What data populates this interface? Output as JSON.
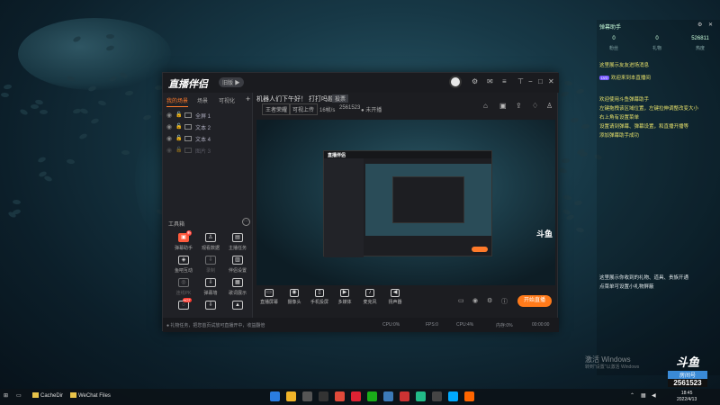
{
  "app": {
    "logo": "直播伴侣",
    "version": "旧版 ▶",
    "scene_tabs": [
      "我的场景",
      "场景",
      "可视化"
    ],
    "sources": [
      {
        "name": "全屏 1",
        "dim": false
      },
      {
        "name": "文本 2",
        "dim": false
      },
      {
        "name": "文本 4",
        "dim": false
      },
      {
        "name": "图片 3",
        "dim": true
      }
    ],
    "tools_heading": "工具箱",
    "tools": [
      {
        "label": "弹幕助手",
        "icon": "▣",
        "badge": "新",
        "highlight": true,
        "dim": false
      },
      {
        "label": "观看数据",
        "icon": "♙",
        "badge": "",
        "highlight": false,
        "dim": false
      },
      {
        "label": "主播任务",
        "icon": "▤",
        "badge": "",
        "highlight": false,
        "dim": false
      },
      {
        "label": "鱼吧互动",
        "icon": "◈",
        "badge": "",
        "highlight": false,
        "dim": false
      },
      {
        "label": "录制",
        "icon": "⇩",
        "badge": "",
        "highlight": false,
        "dim": true
      },
      {
        "label": "伴侣设置",
        "icon": "▥",
        "badge": "",
        "highlight": false,
        "dim": false
      },
      {
        "label": "连线PK",
        "icon": "◎",
        "badge": "",
        "highlight": false,
        "dim": true
      },
      {
        "label": "弹幕墙",
        "icon": "⇩",
        "badge": "",
        "highlight": false,
        "dim": false
      },
      {
        "label": "歌词展示",
        "icon": "▦",
        "badge": "",
        "highlight": false,
        "dim": false
      },
      {
        "label": "",
        "icon": "◌",
        "badge": "HOT",
        "highlight": false,
        "dim": false
      },
      {
        "label": "",
        "icon": "⇩",
        "badge": "",
        "highlight": false,
        "dim": false
      },
      {
        "label": "",
        "icon": "▲",
        "badge": "",
        "highlight": false,
        "dim": false
      }
    ],
    "room_title": "机器人们下午好！ 打打吗题！",
    "vote_label": "投票",
    "row2": {
      "category": "王者荣耀",
      "tag": "可视上传",
      "fps": "16帧/s",
      "room_id": "2561523",
      "status": "● 未开播"
    },
    "bottom_buttons": [
      {
        "label": "直播屏幕",
        "icon": "▭"
      },
      {
        "label": "摄像头",
        "icon": "◉"
      },
      {
        "label": "手机投屏",
        "icon": "▯"
      },
      {
        "label": "多媒体",
        "icon": "▶"
      },
      {
        "label": "麦克风",
        "icon": "♪"
      },
      {
        "label": "扬声器",
        "icon": "◀"
      }
    ],
    "go_live": "开始直播",
    "status_left": "● 礼物任务，把您首页试放可直播开中，收益翻倍",
    "status_items": [
      "CPU:0%",
      "FPS:0",
      "CPU:4%",
      "内存:0%"
    ],
    "status_time": "00:00:00"
  },
  "right_panel": {
    "title": "弹幕助手",
    "stats": [
      {
        "value": "0",
        "key": "粉丝"
      },
      {
        "value": "0",
        "key": "礼物"
      },
      {
        "value": "526811",
        "key": "热度"
      }
    ],
    "lines": [
      {
        "text": "这里展示友友进场消息",
        "white": false
      },
      {
        "text": "欢迎来到本直播间",
        "white": false,
        "level": "LV0"
      },
      {
        "text": "欢迎使用斗鱼弹幕助手",
        "white": false
      },
      {
        "text": "左键拖拽该区域位置，左键拉伸调整改变大小",
        "white": false
      },
      {
        "text": "右上角有设置菜单",
        "white": false
      },
      {
        "text": "设置请到弹幕、弹幕设置，和直播开播等",
        "white": false
      },
      {
        "text": "添加弹幕助手成功",
        "white": false
      }
    ],
    "lower_lines": [
      {
        "text": "这里展示你收到的礼物、道具、贵族开通",
        "white": true
      },
      {
        "text": "点菜单可设置小礼物屏蔽",
        "white": true
      }
    ]
  },
  "desktop": {
    "watermark": "激活 Windows",
    "watermark_sub": "转到\"设置\"以激活 Windows",
    "room_logo": "斗鱼",
    "room_label": "房间号",
    "room_number": "2561523"
  },
  "taskbar": {
    "items": [
      "CacheDir",
      "WeChat Files"
    ],
    "time": "18:45",
    "date": "2022/4/13"
  }
}
